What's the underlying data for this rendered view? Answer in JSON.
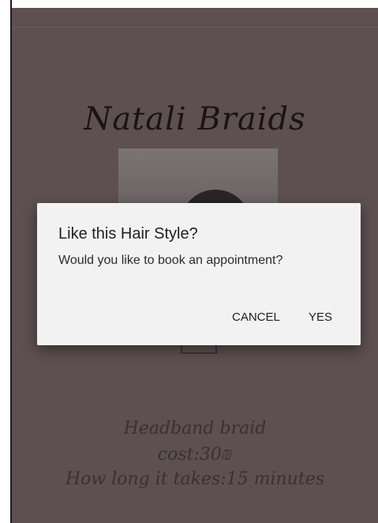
{
  "app": {
    "brand_title": "Natali Braids"
  },
  "hairstyle": {
    "name": "Headband braid",
    "cost": "cost:30₪",
    "duration": "How long it takes:15 minutes"
  },
  "dialog": {
    "title": "Like this Hair Style?",
    "message": "Would you like to book an appointment?",
    "cancel_label": "CANCEL",
    "yes_label": "YES"
  },
  "colors": {
    "scrim_background": "#5e5050",
    "dialog_background": "#f2f2f2",
    "text_dark": "#212121"
  }
}
